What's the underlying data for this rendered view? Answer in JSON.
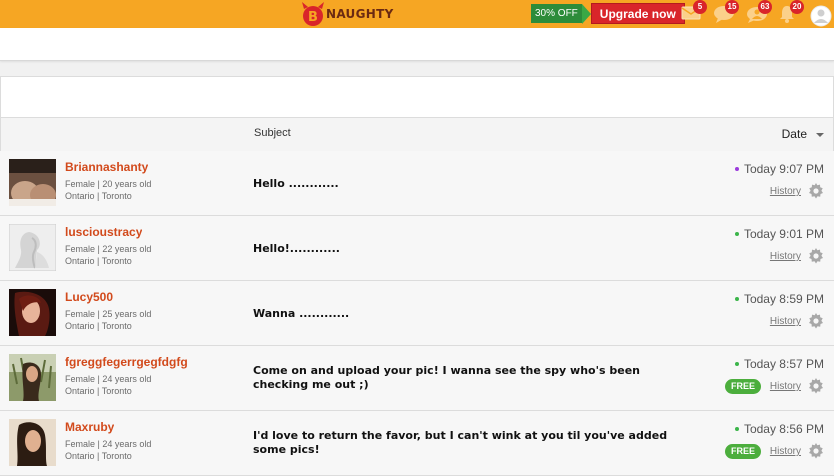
{
  "topbar": {
    "logo_text": "NAUGHTY",
    "promo_badge": "30% OFF",
    "upgrade_label": "Upgrade now",
    "icons": [
      {
        "name": "mail-icon",
        "count": "5"
      },
      {
        "name": "chat-icon",
        "count": "15"
      },
      {
        "name": "contacts-icon",
        "count": "63"
      },
      {
        "name": "bell-icon",
        "count": "20"
      },
      {
        "name": "profile-icon",
        "count": ""
      }
    ],
    "accent_color": "#f6a623"
  },
  "table": {
    "subject_header": "Subject",
    "date_header": "Date"
  },
  "messages": [
    {
      "username": "Briannashanty",
      "gender_age": "Female  |  20 years old",
      "location": "Ontario  |  Toronto",
      "subject": "Hello ............",
      "time": "Today 9:07 PM",
      "history_label": "History",
      "status": "purple",
      "free": ""
    },
    {
      "username": "luscioustracy",
      "gender_age": "Female  |  22 years old",
      "location": "Ontario  |  Toronto",
      "subject": "Hello!............",
      "time": "Today 9:01 PM",
      "history_label": "History",
      "status": "green",
      "free": ""
    },
    {
      "username": "Lucy500",
      "gender_age": "Female  |  25 years old",
      "location": "Ontario  |  Toronto",
      "subject": "Wanna ............",
      "time": "Today 8:59 PM",
      "history_label": "History",
      "status": "green",
      "free": ""
    },
    {
      "username": "fgreggfegerrgegfdgfgr",
      "gender_age": "Female  |  24 years old",
      "location": "Ontario  |  Toronto",
      "subject": "Come on and upload your pic! I wanna see the spy who's been checking me out ;)",
      "time": "Today 8:57 PM",
      "history_label": "History",
      "status": "green",
      "free": "FREE"
    },
    {
      "username": "Maxruby",
      "gender_age": "Female  |  24 years old",
      "location": "Ontario  |  Toronto",
      "subject": "I'd love to return the favor, but I can't wink at you til you've added some pics!",
      "time": "Today 8:56 PM",
      "history_label": "History",
      "status": "green",
      "free": "FREE"
    }
  ]
}
